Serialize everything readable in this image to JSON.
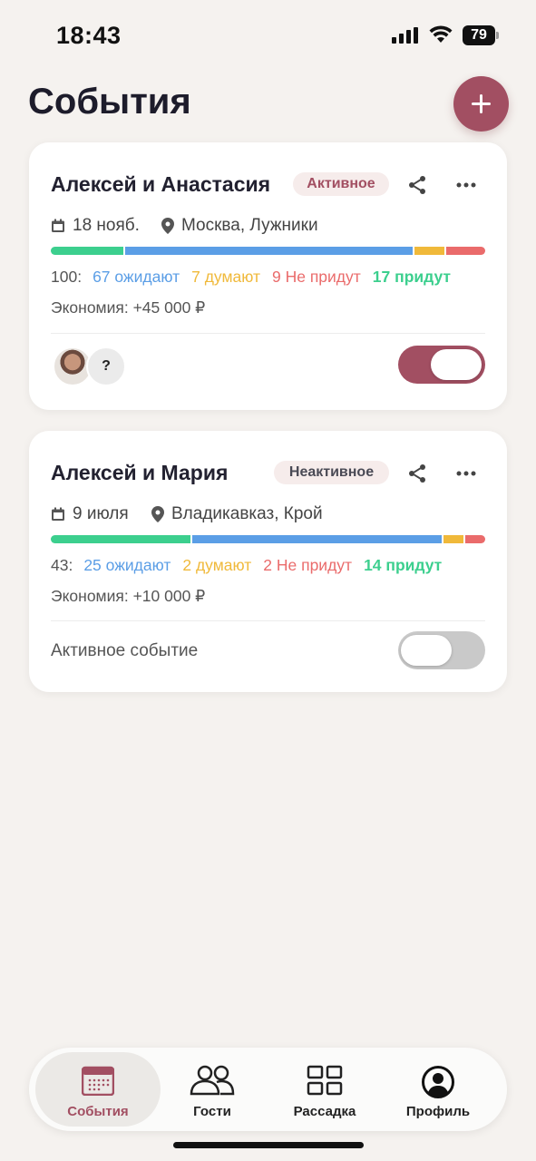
{
  "status_bar": {
    "time": "18:43",
    "battery": "79"
  },
  "header": {
    "title": "События"
  },
  "events": [
    {
      "name": "Алексей и Анастасия",
      "status": "Активное",
      "date": "18 нояб.",
      "location": "Москва, Лужники",
      "total": "100:",
      "waiting": "67 ожидают",
      "thinking": "7 думают",
      "declined": "9 Не придут",
      "coming": "17 придут",
      "progress": [
        17,
        67,
        7,
        9
      ],
      "savings": "Экономия: +45 000 ₽",
      "unknown_avatar": "?",
      "active": true
    },
    {
      "name": "Алексей и Мария",
      "status": "Неактивное",
      "date": "9 июля",
      "location": "Владикавказ, Крой",
      "total": "43:",
      "waiting": "25 ожидают",
      "thinking": "2 думают",
      "declined": "2 Не придут",
      "coming": "14 придут",
      "progress": [
        14,
        25,
        2,
        2
      ],
      "savings": "Экономия: +10 000 ₽",
      "toggle_label": "Активное событие",
      "active": false
    }
  ],
  "colors": {
    "accent": "#a24f62",
    "coming": "#3ccf8e",
    "waiting": "#5b9ee6",
    "thinking": "#f0b93a",
    "declined": "#ea6b6b"
  },
  "nav": [
    {
      "label": "События",
      "icon": "calendar-icon"
    },
    {
      "label": "Гости",
      "icon": "guests-icon"
    },
    {
      "label": "Рассадка",
      "icon": "grid-icon"
    },
    {
      "label": "Профиль",
      "icon": "profile-icon"
    }
  ]
}
